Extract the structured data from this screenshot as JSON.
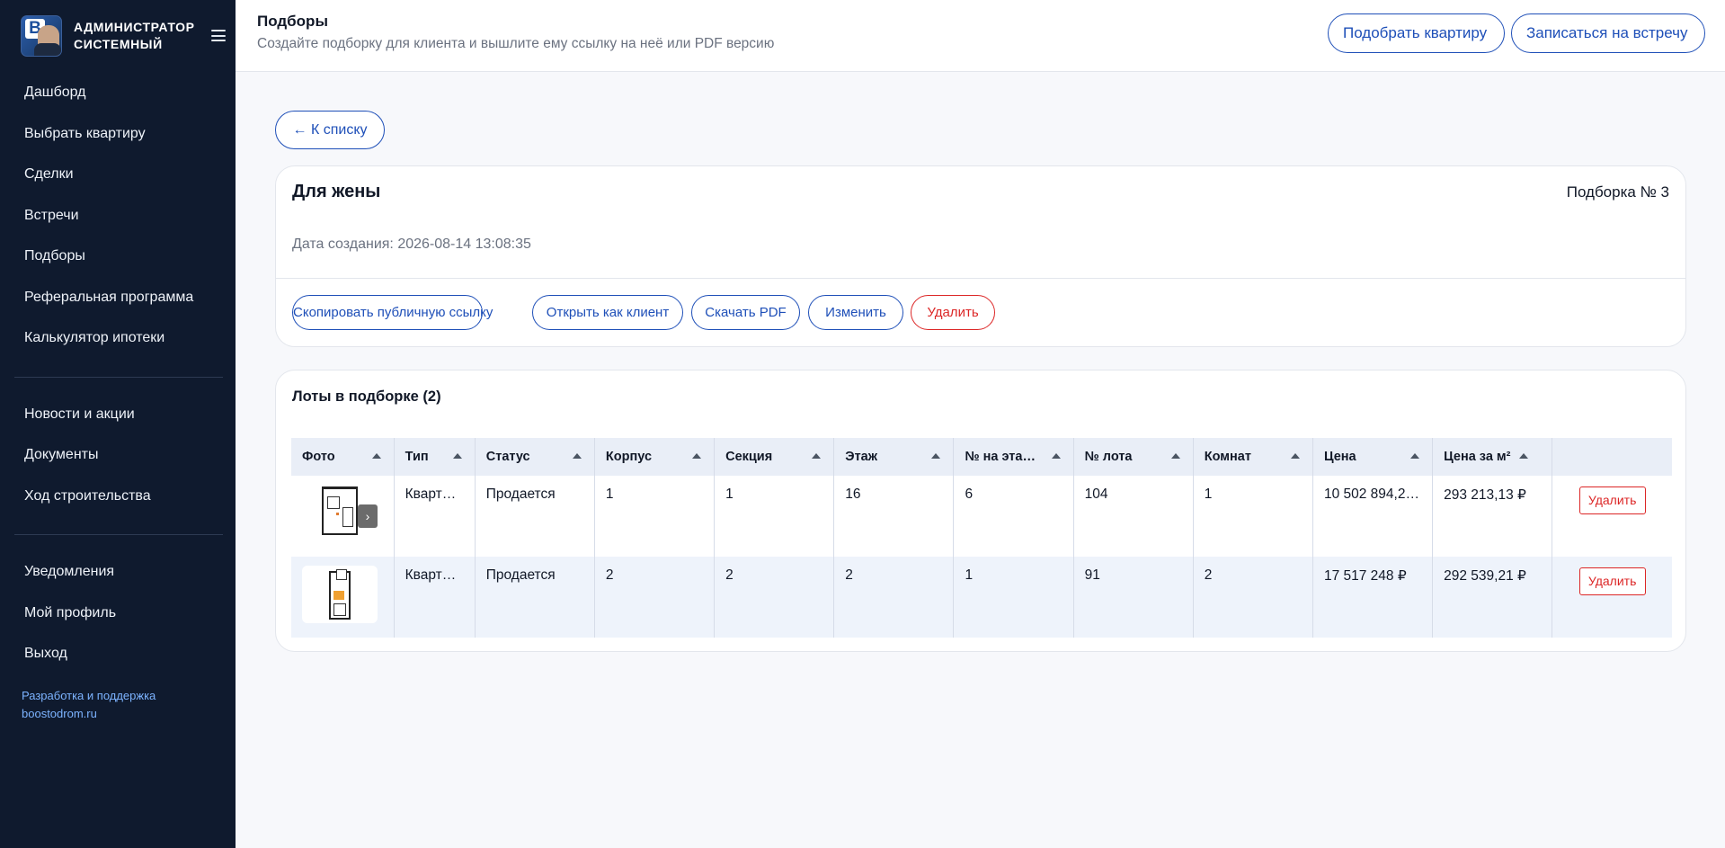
{
  "sidebar": {
    "user_name": "АДМИНИСТРАТОР СИСТЕМНЫЙ",
    "nav_main": [
      "Дашборд",
      "Выбрать квартиру",
      "Сделки",
      "Встречи",
      "Подборы",
      "Реферальная программа",
      "Калькулятор ипотеки"
    ],
    "nav_info": [
      "Новости и акции",
      "Документы",
      "Ход строительства"
    ],
    "nav_account": [
      "Уведомления",
      "Мой профиль",
      "Выход"
    ],
    "footer_line1": "Разработка и поддержка",
    "footer_line2": "boostodrom.ru"
  },
  "header": {
    "title": "Подборы",
    "subtitle": "Создайте подборку для клиента и вышлите ему ссылку на неё или PDF версию",
    "pick_apartment": "Подобрать квартиру",
    "book_meeting": "Записаться на встречу"
  },
  "back_label": "← К списку",
  "selection": {
    "title": "Для жены",
    "number": "Подборка № 3",
    "created_label": "Дата создания:",
    "created_value": "2026-08-14 13:08:35",
    "actions": {
      "copy_link": "Скопировать публичную ссылку",
      "open_as_client": "Открыть как клиент",
      "download_pdf": "Скачать PDF",
      "edit": "Изменить",
      "delete": "Удалить"
    }
  },
  "lots": {
    "title": "Лоты в подборке (2)",
    "columns": [
      "Фото",
      "Тип",
      "Статус",
      "Корпус",
      "Секция",
      "Этаж",
      "№ на эта…",
      "№ лота",
      "Комнат",
      "Цена",
      "Цена за м²"
    ],
    "delete_label": "Удалить",
    "rows": [
      {
        "type": "Кварт…",
        "status": "Продается",
        "building": "1",
        "section": "1",
        "floor": "16",
        "on_floor": "6",
        "lot": "104",
        "rooms": "1",
        "price": "10 502 894,2…",
        "price_sqm": "293 213,13 ₽"
      },
      {
        "type": "Кварт…",
        "status": "Продается",
        "building": "2",
        "section": "2",
        "floor": "2",
        "on_floor": "1",
        "lot": "91",
        "rooms": "2",
        "price": "17 517 248 ₽",
        "price_sqm": "292 539,21 ₽"
      }
    ]
  },
  "colors": {
    "sidebar_bg": "#0f1a2e",
    "accent": "#1e4fb8",
    "danger": "#dc2626",
    "link": "#7cb3ff"
  }
}
